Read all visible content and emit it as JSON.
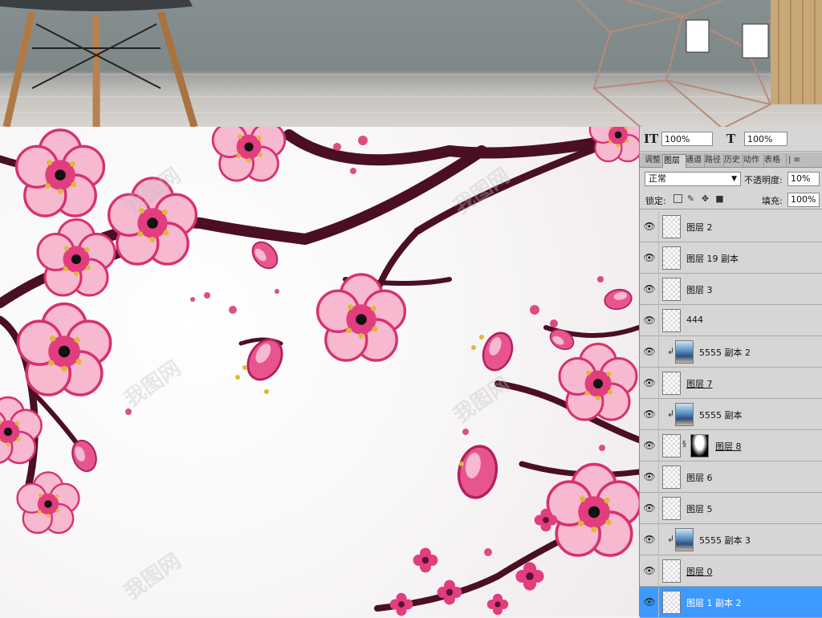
{
  "panel": {
    "vertical_scale": "100%",
    "horizontal_scale": "100%",
    "tabs": [
      "调整",
      "图层",
      "通道",
      "路径",
      "历史",
      "动作",
      "表格"
    ],
    "active_tab": "图层",
    "blend_mode": "正常",
    "opacity_label": "不透明度:",
    "opacity_value": "10%",
    "lock_label": "锁定:",
    "fill_label": "填充:",
    "fill_value": "100%",
    "layers": [
      {
        "name": "图层 2",
        "thumb": "transparent",
        "visible": true
      },
      {
        "name": "图层 19 副本",
        "thumb": "transparent",
        "visible": true
      },
      {
        "name": "图层 3",
        "thumb": "transparent",
        "visible": true
      },
      {
        "name": "444",
        "thumb": "transparent",
        "visible": true
      },
      {
        "name": "5555 副本 2",
        "thumb": "photo",
        "visible": true,
        "clipped": true
      },
      {
        "name": "图层 7",
        "thumb": "transparent",
        "visible": true,
        "underline": true
      },
      {
        "name": "5555 副本",
        "thumb": "photo",
        "visible": true,
        "clipped": true
      },
      {
        "name": "图层 8",
        "thumb": "transparent",
        "visible": true,
        "mask": true,
        "underline": true
      },
      {
        "name": "图层 6",
        "thumb": "transparent",
        "visible": true
      },
      {
        "name": "图层 5",
        "thumb": "transparent",
        "visible": true
      },
      {
        "name": "5555 副本 3",
        "thumb": "photo",
        "visible": true,
        "clipped": true
      },
      {
        "name": "图层 0",
        "thumb": "transparent",
        "visible": true,
        "underline": true
      },
      {
        "name": "图层 1 副本 2",
        "thumb": "transparent",
        "visible": true,
        "selected": true
      }
    ]
  },
  "colors": {
    "selected_layer": "#3d9aff",
    "branch": "#4a0f22",
    "blossom_dark": "#e23d7f",
    "blossom_light": "#f6b9cf"
  },
  "icons": {
    "vertical_scale": "vertical-scale-icon",
    "horizontal_scale": "horizontal-scale-icon",
    "visibility": "eye-icon",
    "lock_transparent": "lock-transparent-icon",
    "lock_paint": "brush-icon",
    "lock_move": "move-icon",
    "lock_all": "lock-icon"
  }
}
